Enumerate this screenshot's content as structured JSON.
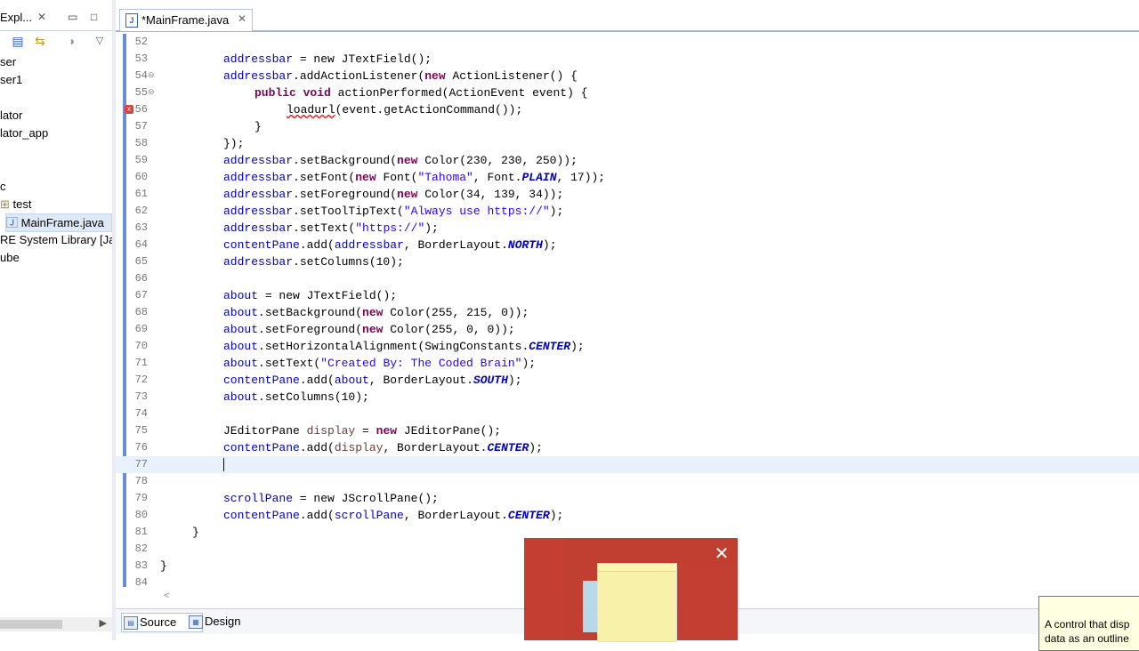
{
  "explorer": {
    "tab_label": "Expl...",
    "close_glyph": "✕",
    "items": [
      {
        "label": "ser"
      },
      {
        "label": "ser1"
      },
      {
        "label": "lator"
      },
      {
        "label": "lator_app"
      },
      {
        "label": "c"
      },
      {
        "label": "test"
      },
      {
        "label": "MainFrame.java"
      },
      {
        "label": "RE System Library [Jav"
      },
      {
        "label": "ube"
      }
    ]
  },
  "editor": {
    "tab_label": "*MainFrame.java",
    "close_glyph": "✕",
    "bottom_tabs": {
      "source": "Source",
      "design": "Design"
    }
  },
  "lines": {
    "n52": "52",
    "n53": "53",
    "n54": "54",
    "n55": "55",
    "n56": "56",
    "n57": "57",
    "n58": "58",
    "n59": "59",
    "n60": "60",
    "n61": "61",
    "n62": "62",
    "n63": "63",
    "n64": "64",
    "n65": "65",
    "n66": "66",
    "n67": "67",
    "n68": "68",
    "n69": "69",
    "n70": "70",
    "n71": "71",
    "n72": "72",
    "n73": "73",
    "n74": "74",
    "n75": "75",
    "n76": "76",
    "n77": "77",
    "n78": "78",
    "n79": "79",
    "n80": "80",
    "n81": "81",
    "n82": "82",
    "n83": "83",
    "n84": "84"
  },
  "tok": {
    "addressbar": "addressbar",
    "about": "about",
    "contentPane": "contentPane",
    "scrollPane": "scrollPane",
    "display": "display",
    "new": "new",
    "public": "public",
    "void": "void",
    "s53": " = new JTextField();",
    "s54a": ".addActionListener(",
    "s54b": " ActionListener() {",
    "s55": " actionPerformed(ActionEvent event) {",
    "s56a": "loadurl",
    "s56b": "(event.getActionCommand());",
    "s57": "}",
    "s58": "});",
    "s59a": ".setBackground(",
    "s59b": " Color(230, 230, 250));",
    "s60a": ".setFont(",
    "s60b": " Font(",
    "s60str": "\"Tahoma\"",
    "s60c": ", Font.",
    "s60cst": "PLAIN",
    "s60d": ", 17));",
    "s61a": ".setForeground(",
    "s61b": " Color(34, 139, 34));",
    "s62a": ".setToolTipText(",
    "s62str": "\"Always use https://\"",
    "s62b": ");",
    "s63a": ".setText(",
    "s63str": "\"https://\"",
    "s63b": ");",
    "s64a": ".add(",
    "s64b": ", BorderLayout.",
    "NORTH": "NORTH",
    "s64c": ");",
    "s65": ".setColumns(10);",
    "s67": " = new JTextField();",
    "s68a": ".setBackground(",
    "s68b": " Color(255, 215, 0));",
    "s69a": ".setForeground(",
    "s69b": " Color(255, 0, 0));",
    "s70a": ".setHorizontalAlignment(SwingConstants.",
    "CENTER": "CENTER",
    "s70b": ");",
    "s71a": ".setText(",
    "s71str": "\"Created By: The Coded Brain\"",
    "s71b": ");",
    "SOUTH": "SOUTH",
    "s73": ".setColumns(10);",
    "s75a": "JEditorPane ",
    "s75b": " = ",
    "s75c": " JEditorPane();",
    "s79": " = new JScrollPane();",
    "s81": "}",
    "s83": "}"
  },
  "tooltip": {
    "line1": "A control that disp",
    "line2": "data as an outline"
  },
  "popup": {
    "close_glyph": "✕"
  }
}
